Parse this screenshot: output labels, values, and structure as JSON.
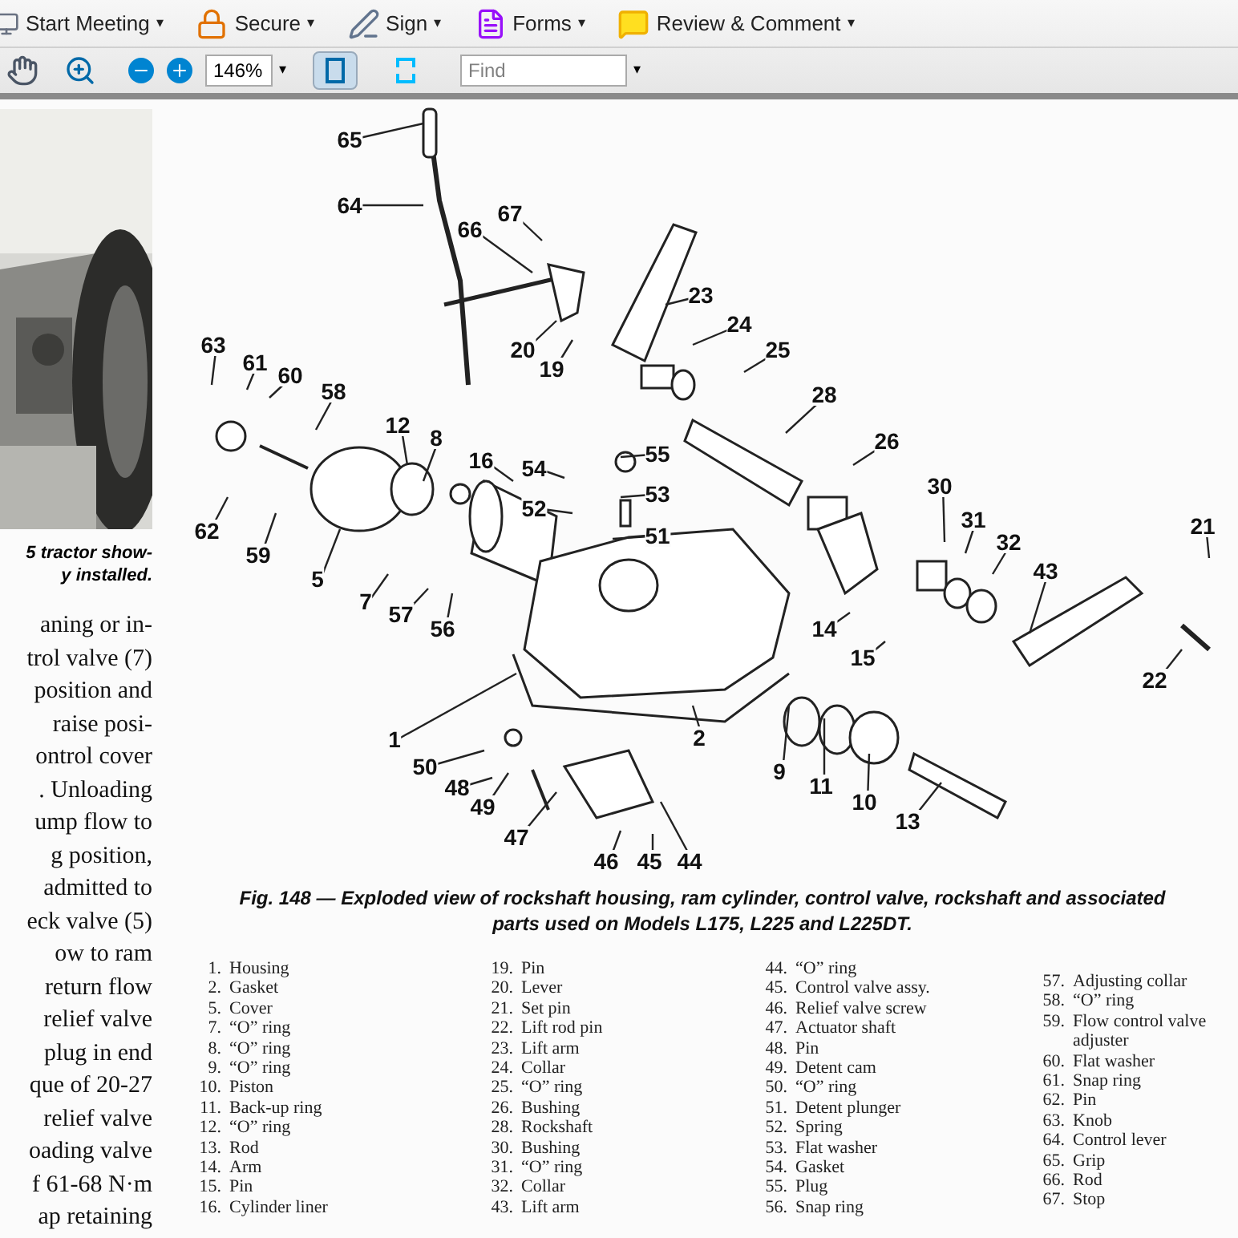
{
  "toolbar": {
    "menus": [
      {
        "kind": "meeting",
        "label": "Start Meeting",
        "caret": "▾"
      },
      {
        "kind": "secure",
        "label": "Secure",
        "caret": "▾"
      },
      {
        "kind": "sign",
        "label": "Sign",
        "caret": "▾"
      },
      {
        "kind": "forms",
        "label": "Forms",
        "caret": "▾"
      },
      {
        "kind": "review",
        "label": "Review & Comment",
        "caret": "▾"
      }
    ],
    "zoom": {
      "value": "146%",
      "caret": "▾"
    },
    "view_buttons": [
      {
        "kind": "fit-width",
        "selected": true
      },
      {
        "kind": "fit-window",
        "selected": false
      }
    ],
    "find": {
      "placeholder": "Find",
      "caret": "▾"
    }
  },
  "page": {
    "photo_caption": [
      "5 tractor show-",
      "y installed."
    ],
    "body_lines": [
      "aning or in-",
      "trol valve (7)",
      "position and",
      "raise posi-",
      "ontrol cover",
      ". Unloading",
      "ump flow to",
      "g position,",
      "admitted to",
      "eck valve (5)",
      "ow to ram",
      "return flow",
      "relief valve",
      "plug in end",
      "que of 20-27",
      "relief valve",
      "oading valve",
      "f 61-68 N·m",
      "ap retaining"
    ],
    "callouts": [
      "65",
      "64",
      "66",
      "67",
      "23",
      "63",
      "24",
      "61",
      "60",
      "58",
      "20",
      "19",
      "25",
      "28",
      "12",
      "8",
      "16",
      "54",
      "55",
      "26",
      "62",
      "52",
      "53",
      "30",
      "59",
      "51",
      "31",
      "32",
      "21",
      "5",
      "43",
      "7",
      "57",
      "56",
      "14",
      "15",
      "22",
      "1",
      "2",
      "50",
      "48",
      "9",
      "49",
      "11",
      "10",
      "47",
      "13",
      "46",
      "45",
      "44"
    ],
    "figure_caption": [
      "Fig. 148 — Exploded view of rockshaft housing, ram cylinder, control valve, rockshaft and associated",
      "parts used on Models L175, L225 and L225DT."
    ],
    "legend_columns": [
      [
        {
          "num": "1.",
          "name": "Housing"
        },
        {
          "num": "2.",
          "name": "Gasket"
        },
        {
          "num": "5.",
          "name": "Cover"
        },
        {
          "num": "7.",
          "name": "“O” ring"
        },
        {
          "num": "8.",
          "name": "“O” ring"
        },
        {
          "num": "9.",
          "name": "“O” ring"
        },
        {
          "num": "10.",
          "name": "Piston"
        },
        {
          "num": "11.",
          "name": "Back-up ring"
        },
        {
          "num": "12.",
          "name": "“O” ring"
        },
        {
          "num": "13.",
          "name": "Rod"
        },
        {
          "num": "14.",
          "name": "Arm"
        },
        {
          "num": "15.",
          "name": "Pin"
        },
        {
          "num": "16.",
          "name": "Cylinder liner"
        }
      ],
      [
        {
          "num": "19.",
          "name": "Pin"
        },
        {
          "num": "20.",
          "name": "Lever"
        },
        {
          "num": "21.",
          "name": "Set pin"
        },
        {
          "num": "22.",
          "name": "Lift rod pin"
        },
        {
          "num": "23.",
          "name": "Lift arm"
        },
        {
          "num": "24.",
          "name": "Collar"
        },
        {
          "num": "25.",
          "name": "“O” ring"
        },
        {
          "num": "26.",
          "name": "Bushing"
        },
        {
          "num": "28.",
          "name": "Rockshaft"
        },
        {
          "num": "30.",
          "name": "Bushing"
        },
        {
          "num": "31.",
          "name": "“O” ring"
        },
        {
          "num": "32.",
          "name": "Collar"
        },
        {
          "num": "43.",
          "name": "Lift arm"
        }
      ],
      [
        {
          "num": "44.",
          "name": "“O” ring"
        },
        {
          "num": "45.",
          "name": "Control valve assy."
        },
        {
          "num": "46.",
          "name": "Relief valve screw"
        },
        {
          "num": "47.",
          "name": "Actuator shaft"
        },
        {
          "num": "48.",
          "name": "Pin"
        },
        {
          "num": "49.",
          "name": "Detent cam"
        },
        {
          "num": "50.",
          "name": "“O” ring"
        },
        {
          "num": "51.",
          "name": "Detent plunger"
        },
        {
          "num": "52.",
          "name": "Spring"
        },
        {
          "num": "53.",
          "name": "Flat washer"
        },
        {
          "num": "54.",
          "name": "Gasket"
        },
        {
          "num": "55.",
          "name": "Plug"
        },
        {
          "num": "56.",
          "name": "Snap ring"
        }
      ],
      [
        {
          "num": "57.",
          "name": "Adjusting collar"
        },
        {
          "num": "58.",
          "name": "“O” ring"
        },
        {
          "num": "59.",
          "name": "Flow control valve adjuster"
        },
        {
          "num": "60.",
          "name": "Flat washer"
        },
        {
          "num": "61.",
          "name": "Snap ring"
        },
        {
          "num": "62.",
          "name": "Pin"
        },
        {
          "num": "63.",
          "name": "Knob"
        },
        {
          "num": "64.",
          "name": "Control lever"
        },
        {
          "num": "65.",
          "name": "Grip"
        },
        {
          "num": "66.",
          "name": "Rod"
        },
        {
          "num": "67.",
          "name": "Stop"
        }
      ]
    ]
  }
}
